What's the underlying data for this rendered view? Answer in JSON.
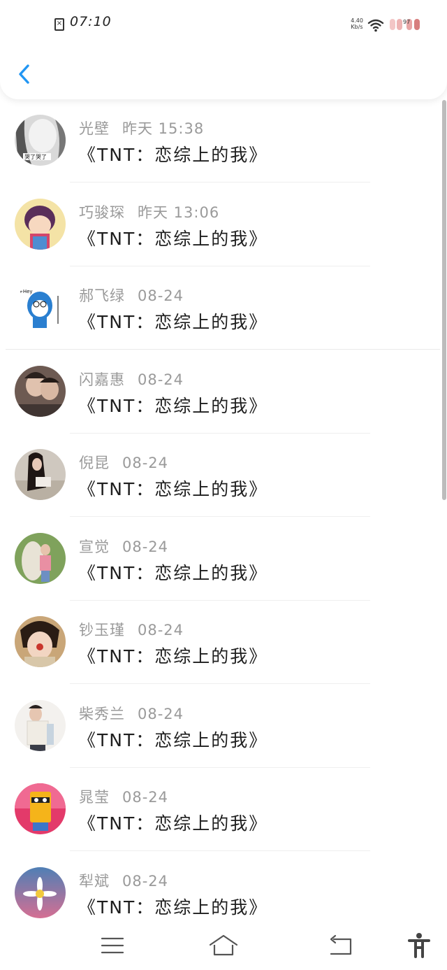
{
  "status_bar": {
    "time": "07:10",
    "net_speed_value": "4.40",
    "net_speed_unit": "Kb/s",
    "battery_level": "97",
    "icons": [
      "sim-card-icon",
      "wifi-icon",
      "battery-icon"
    ]
  },
  "header": {
    "back_icon": "chevron-left-icon",
    "accent_color": "#2196F3"
  },
  "items": [
    {
      "name": "光壁",
      "date": "昨天 15:38",
      "title": "《TNT：恋综上的我》"
    },
    {
      "name": "巧骏琛",
      "date": "昨天 13:06",
      "title": "《TNT：恋综上的我》"
    },
    {
      "name": "郝飞绿",
      "date": "08-24",
      "title": "《TNT：恋综上的我》"
    },
    {
      "name": "闪嘉惠",
      "date": "08-24",
      "title": "《TNT：恋综上的我》"
    },
    {
      "name": "倪昆",
      "date": "08-24",
      "title": "《TNT：恋综上的我》"
    },
    {
      "name": "宣觉",
      "date": "08-24",
      "title": "《TNT：恋综上的我》"
    },
    {
      "name": "钞玉瑾",
      "date": "08-24",
      "title": "《TNT：恋综上的我》"
    },
    {
      "name": "柴秀兰",
      "date": "08-24",
      "title": "《TNT：恋综上的我》"
    },
    {
      "name": "晁莹",
      "date": "08-24",
      "title": "《TNT：恋综上的我》"
    },
    {
      "name": "犁斌",
      "date": "08-24",
      "title": "《TNT：恋综上的我》"
    }
  ],
  "bottom_nav": {
    "icons": [
      "menu-icon",
      "home-icon",
      "back-icon",
      "accessibility-icon"
    ]
  }
}
